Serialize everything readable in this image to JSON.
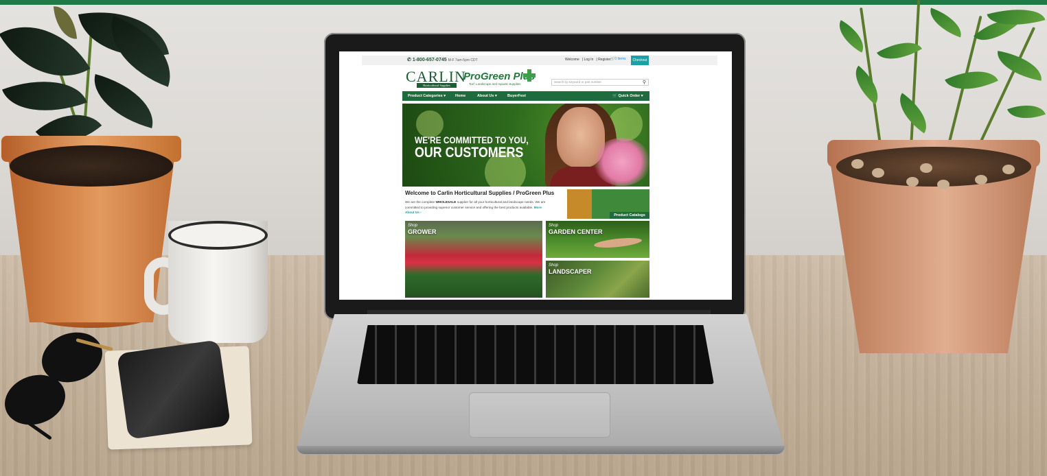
{
  "site": {
    "util_bar": {
      "phone": "1-800-657-0745",
      "hours": "M-F 7am-5pm CDT",
      "welcome": "Welcome",
      "login": "Log In",
      "register": "Register",
      "cart_items": "0 Items",
      "checkout": "Checkout"
    },
    "logos": {
      "carlin": "CARLIN",
      "carlin_sub": "Horticultural Supplies",
      "progreen": "ProGreen Plus",
      "progreen_sub": "Turf, Landscape and Aquatic Supplies"
    },
    "search": {
      "placeholder": "Search by keyword or part number"
    },
    "nav": {
      "items": [
        "Product Categories ▾",
        "Home",
        "About Us ▾",
        "BuyerFest"
      ],
      "quick_order": "Quick Order ▾"
    },
    "hero": {
      "line1": "WE'RE COMMITTED TO YOU,",
      "line2": "OUR CUSTOMERS"
    },
    "welcome": {
      "title": "Welcome to Carlin Horticultural Supplies / ProGreen Plus",
      "body_before": "We are the complete ",
      "body_bold": "WHOLESALE",
      "body_after": " supplier for all your horticultural and landscape needs. We are committed to providing superior customer service and offering the best products available. ",
      "more_link": "More About Us ›"
    },
    "catalog": {
      "label": "Product Catalogs"
    },
    "tiles": [
      {
        "shop": "Shop",
        "name": "GROWER"
      },
      {
        "shop": "Shop",
        "name": "GARDEN CENTER"
      },
      {
        "shop": "Shop",
        "name": "LANDSCAPER"
      }
    ]
  },
  "colors": {
    "brand_green": "#1e6b3e",
    "accent_teal": "#1aa0a8",
    "top_band": "#1f7a45"
  }
}
